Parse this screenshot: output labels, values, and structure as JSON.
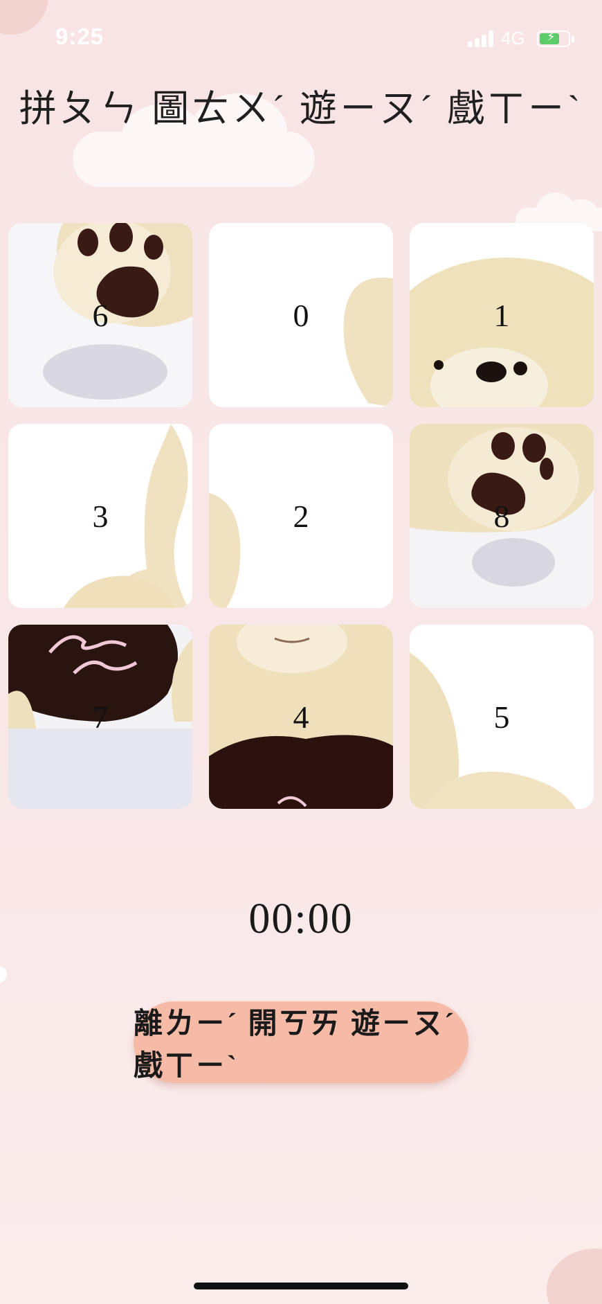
{
  "status_bar": {
    "time": "9:25",
    "network": "4G",
    "signal_bars": 4,
    "battery_charging": true
  },
  "title": "拼ㄆㄣ 圖ㄊㄨˊ 遊ㄧㄡˊ 戲ㄒㄧˋ",
  "tiles": [
    {
      "number": "6",
      "image": "bear-paw-top"
    },
    {
      "number": "0",
      "image": "bear-edge-right"
    },
    {
      "number": "1",
      "image": "bear-face"
    },
    {
      "number": "3",
      "image": "bear-arm-right"
    },
    {
      "number": "2",
      "image": "bear-edge-left"
    },
    {
      "number": "8",
      "image": "bear-paw"
    },
    {
      "number": "7",
      "image": "heart-love-you"
    },
    {
      "number": "4",
      "image": "bear-body-heart"
    },
    {
      "number": "5",
      "image": "bear-leg"
    }
  ],
  "timer": "00:00",
  "leave_button": {
    "label": "離ㄌㄧˊ 開ㄎㄞ 遊ㄧㄡˊ 戲ㄒㄧˋ"
  },
  "colors": {
    "background": "#f9e8e9",
    "button": "#f5bba7",
    "plush": "#f1e3c2",
    "paw": "#3a1a14"
  }
}
